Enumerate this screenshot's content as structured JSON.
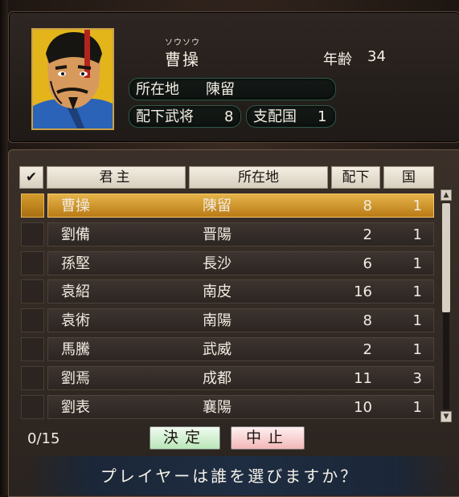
{
  "profile": {
    "name_ruby": "ソウソウ",
    "name": "曹操",
    "age_label": "年齢",
    "age_value": "34",
    "location_label": "所在地",
    "location_value": "陳留",
    "generals_label": "配下武将",
    "generals_value": "8",
    "provinces_label": "支配国",
    "provinces_value": "1"
  },
  "table": {
    "headers": {
      "check": "✔",
      "ruler": "君主",
      "location": "所在地",
      "subordinates": "配下",
      "provinces": "国"
    },
    "rows": [
      {
        "ruler": "曹操",
        "location": "陳留",
        "subordinates": "8",
        "provinces": "1"
      },
      {
        "ruler": "劉備",
        "location": "晋陽",
        "subordinates": "2",
        "provinces": "1"
      },
      {
        "ruler": "孫堅",
        "location": "長沙",
        "subordinates": "6",
        "provinces": "1"
      },
      {
        "ruler": "袁紹",
        "location": "南皮",
        "subordinates": "16",
        "provinces": "1"
      },
      {
        "ruler": "袁術",
        "location": "南陽",
        "subordinates": "8",
        "provinces": "1"
      },
      {
        "ruler": "馬騰",
        "location": "武威",
        "subordinates": "2",
        "provinces": "1"
      },
      {
        "ruler": "劉焉",
        "location": "成都",
        "subordinates": "11",
        "provinces": "3"
      },
      {
        "ruler": "劉表",
        "location": "襄陽",
        "subordinates": "10",
        "provinces": "1"
      }
    ]
  },
  "footer": {
    "count": "0/15",
    "ok_label": "決定",
    "cancel_label": "中止",
    "prompt": "プレイヤーは誰を選びますか？"
  },
  "colors": {
    "selected_row": "#d69a2a",
    "accent_green": "#2f5a49"
  }
}
